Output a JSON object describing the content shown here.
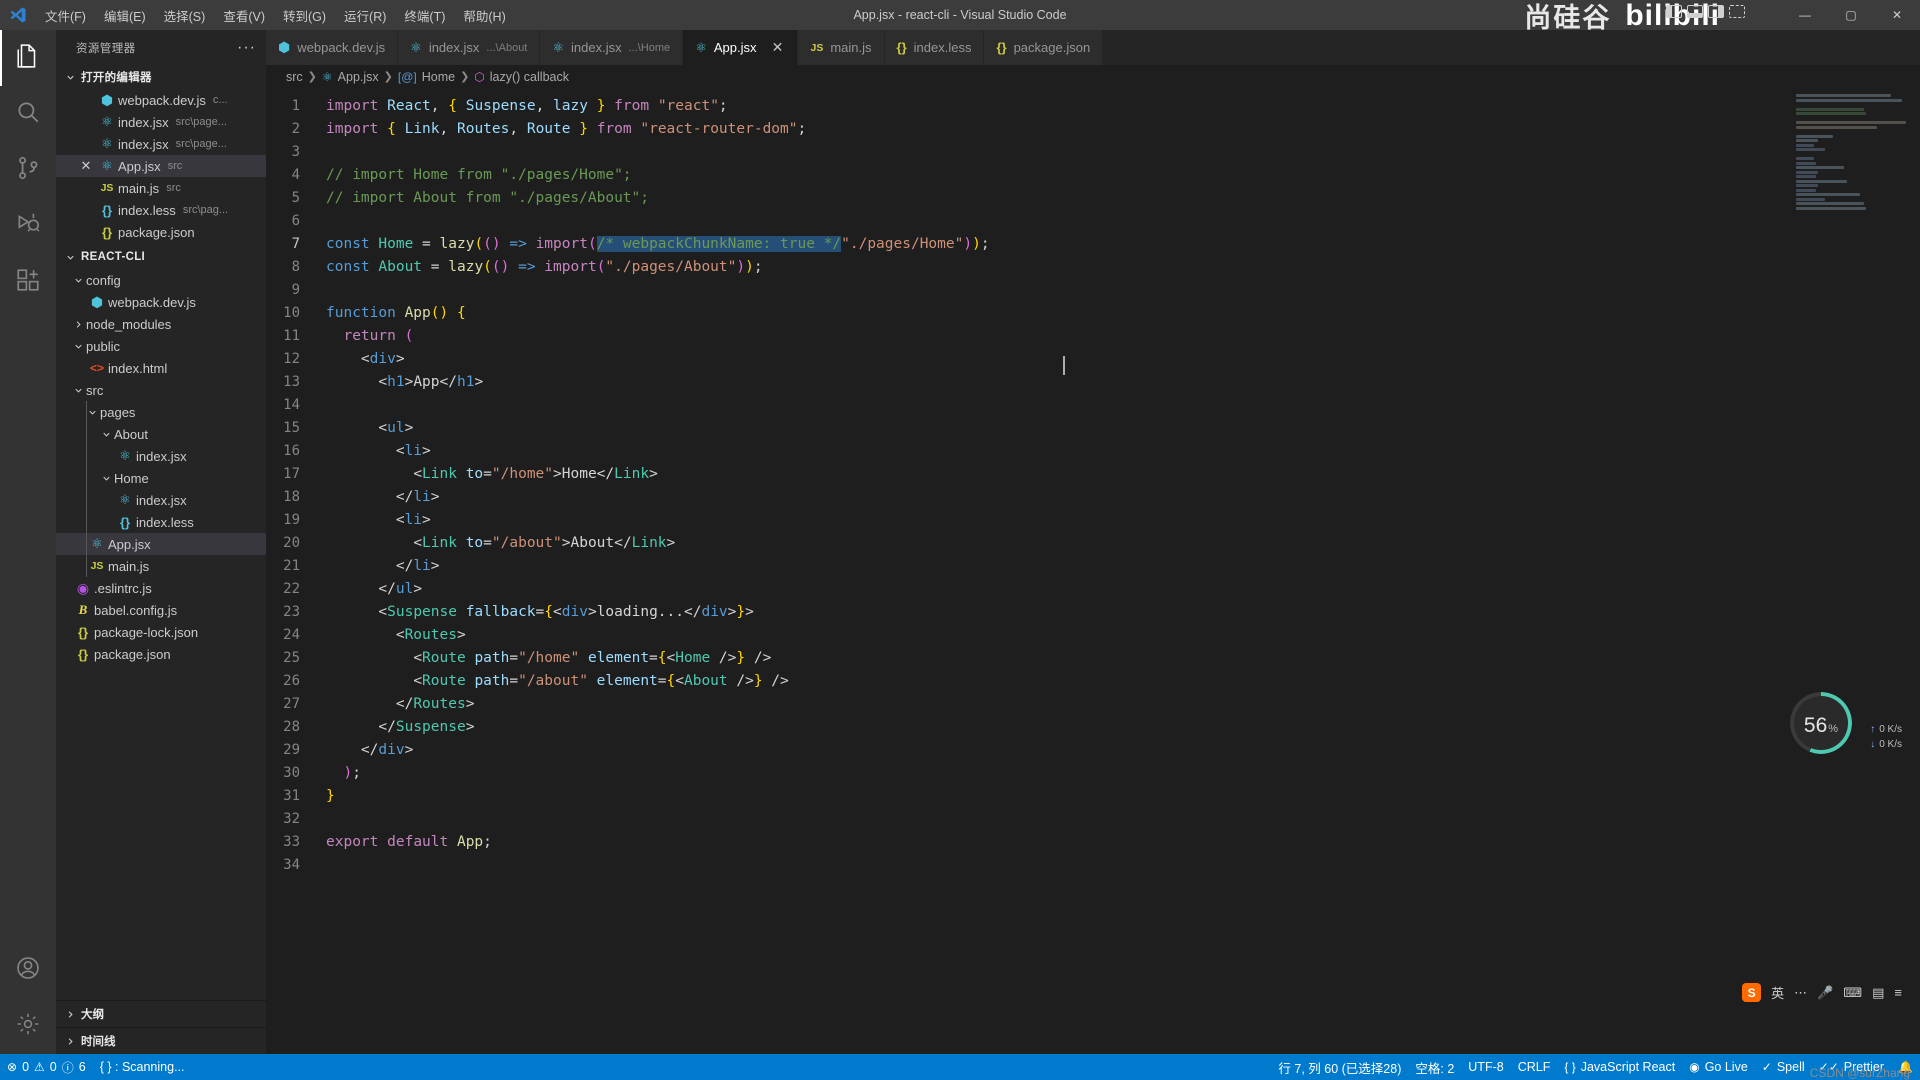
{
  "titlebar": {
    "logo_icon": "vscode-logo-icon",
    "window_title": "App.jsx - react-cli - Visual Studio Code",
    "menus": [
      {
        "label": "文件(F)",
        "name": "menu-file"
      },
      {
        "label": "编辑(E)",
        "name": "menu-edit"
      },
      {
        "label": "选择(S)",
        "name": "menu-selection"
      },
      {
        "label": "查看(V)",
        "name": "menu-view"
      },
      {
        "label": "转到(G)",
        "name": "menu-go"
      },
      {
        "label": "运行(R)",
        "name": "menu-run"
      },
      {
        "label": "终端(T)",
        "name": "menu-terminal"
      },
      {
        "label": "帮助(H)",
        "name": "menu-help"
      }
    ],
    "brand_cn": "尚硅谷",
    "brand_bili": "bilibili",
    "window_controls": {
      "minimize": "—",
      "maximize": "▢",
      "close": "✕"
    }
  },
  "activitybar": {
    "items": [
      {
        "name": "explorer",
        "icon": "files-icon",
        "active": true
      },
      {
        "name": "search",
        "icon": "search-icon",
        "active": false
      },
      {
        "name": "source-control",
        "icon": "source-control-icon",
        "active": false
      },
      {
        "name": "run-debug",
        "icon": "run-debug-icon",
        "active": false
      },
      {
        "name": "extensions",
        "icon": "extensions-icon",
        "active": false
      }
    ],
    "bottom": [
      {
        "name": "accounts",
        "icon": "account-icon"
      },
      {
        "name": "settings",
        "icon": "gear-icon"
      }
    ]
  },
  "sidebar": {
    "title": "资源管理器",
    "more_actions": "···",
    "open_editors": {
      "label": "打开的编辑器",
      "items": [
        {
          "name": "webpack.dev.js",
          "desc": "c...",
          "icon": "webpack-icon",
          "selected": false,
          "closable": false
        },
        {
          "name": "index.jsx",
          "desc": "src\\page...",
          "icon": "react-icon",
          "selected": false,
          "closable": false
        },
        {
          "name": "index.jsx",
          "desc": "src\\page...",
          "icon": "react-icon",
          "selected": false,
          "closable": false
        },
        {
          "name": "App.jsx",
          "desc": "src",
          "icon": "react-icon",
          "selected": true,
          "closable": true
        },
        {
          "name": "main.js",
          "desc": "src",
          "icon": "js-icon",
          "selected": false,
          "closable": false
        },
        {
          "name": "index.less",
          "desc": "src\\pag...",
          "icon": "less-icon",
          "selected": false,
          "closable": false
        },
        {
          "name": "package.json",
          "desc": "",
          "icon": "json-icon",
          "selected": false,
          "closable": false
        }
      ]
    },
    "project": {
      "label": "REACT-CLI",
      "tree": [
        {
          "name": "config",
          "type": "folder",
          "expanded": true,
          "indent": 1,
          "icon": "chevron-down-icon"
        },
        {
          "name": "webpack.dev.js",
          "type": "file",
          "indent": 2,
          "icon": "webpack-icon"
        },
        {
          "name": "node_modules",
          "type": "folder",
          "expanded": false,
          "indent": 1,
          "icon": "chevron-right-icon"
        },
        {
          "name": "public",
          "type": "folder",
          "expanded": true,
          "indent": 1,
          "icon": "chevron-down-icon"
        },
        {
          "name": "index.html",
          "type": "file",
          "indent": 2,
          "icon": "html-icon"
        },
        {
          "name": "src",
          "type": "folder",
          "expanded": true,
          "indent": 1,
          "icon": "chevron-down-icon"
        },
        {
          "name": "pages",
          "type": "folder",
          "expanded": true,
          "indent": 2,
          "icon": "chevron-down-icon"
        },
        {
          "name": "About",
          "type": "folder",
          "expanded": true,
          "indent": 3,
          "icon": "chevron-down-icon"
        },
        {
          "name": "index.jsx",
          "type": "file",
          "indent": 4,
          "icon": "react-icon"
        },
        {
          "name": "Home",
          "type": "folder",
          "expanded": true,
          "indent": 3,
          "icon": "chevron-down-icon"
        },
        {
          "name": "index.jsx",
          "type": "file",
          "indent": 4,
          "icon": "react-icon"
        },
        {
          "name": "index.less",
          "type": "file",
          "indent": 4,
          "icon": "less-icon"
        },
        {
          "name": "App.jsx",
          "type": "file",
          "indent": 2,
          "icon": "react-icon",
          "selected": true
        },
        {
          "name": "main.js",
          "type": "file",
          "indent": 2,
          "icon": "js-icon"
        },
        {
          "name": ".eslintrc.js",
          "type": "file",
          "indent": 1,
          "icon": "eslint-icon"
        },
        {
          "name": "babel.config.js",
          "type": "file",
          "indent": 1,
          "icon": "babel-icon"
        },
        {
          "name": "package-lock.json",
          "type": "file",
          "indent": 1,
          "icon": "json-icon"
        },
        {
          "name": "package.json",
          "type": "file",
          "indent": 1,
          "icon": "json-icon"
        }
      ]
    },
    "collapsed_sections": [
      {
        "label": "大纲",
        "name": "outline-section"
      },
      {
        "label": "时间线",
        "name": "timeline-section"
      }
    ]
  },
  "tabs": [
    {
      "label": "webpack.dev.js",
      "desc": "",
      "icon": "webpack-icon",
      "active": false,
      "closable": false
    },
    {
      "label": "index.jsx",
      "desc": "...\\About",
      "icon": "react-icon",
      "active": false,
      "closable": false
    },
    {
      "label": "index.jsx",
      "desc": "...\\Home",
      "icon": "react-icon",
      "active": false,
      "closable": false
    },
    {
      "label": "App.jsx",
      "desc": "",
      "icon": "react-icon",
      "active": true,
      "closable": true
    },
    {
      "label": "main.js",
      "desc": "",
      "icon": "js-icon",
      "active": false,
      "closable": false
    },
    {
      "label": "index.less",
      "desc": "",
      "icon": "json-icon",
      "active": false,
      "closable": false
    },
    {
      "label": "package.json",
      "desc": "",
      "icon": "json-icon",
      "active": false,
      "closable": false
    }
  ],
  "breadcrumb": [
    {
      "label": "src",
      "icon": ""
    },
    {
      "label": "App.jsx",
      "icon": "react-icon"
    },
    {
      "label": "Home",
      "icon": "constant-icon"
    },
    {
      "label": "lazy() callback",
      "icon": "symbol-icon"
    }
  ],
  "editor": {
    "line_count": 34,
    "cursor_line": 7,
    "lines": [
      {
        "n": 1,
        "text": "import React, { Suspense, lazy } from \"react\";"
      },
      {
        "n": 2,
        "text": "import { Link, Routes, Route } from \"react-router-dom\";"
      },
      {
        "n": 3,
        "text": ""
      },
      {
        "n": 4,
        "text": "// import Home from \"./pages/Home\";"
      },
      {
        "n": 5,
        "text": "// import About from \"./pages/About\";"
      },
      {
        "n": 6,
        "text": ""
      },
      {
        "n": 7,
        "text": "const Home = lazy(() => import(/* webpackChunkName: true */\"./pages/Home\"));"
      },
      {
        "n": 8,
        "text": "const About = lazy(() => import(\"./pages/About\"));"
      },
      {
        "n": 9,
        "text": ""
      },
      {
        "n": 10,
        "text": "function App() {"
      },
      {
        "n": 11,
        "text": "  return ("
      },
      {
        "n": 12,
        "text": "    <div>"
      },
      {
        "n": 13,
        "text": "      <h1>App</h1>"
      },
      {
        "n": 14,
        "text": ""
      },
      {
        "n": 15,
        "text": "      <ul>"
      },
      {
        "n": 16,
        "text": "        <li>"
      },
      {
        "n": 17,
        "text": "          <Link to=\"/home\">Home</Link>"
      },
      {
        "n": 18,
        "text": "        </li>"
      },
      {
        "n": 19,
        "text": "        <li>"
      },
      {
        "n": 20,
        "text": "          <Link to=\"/about\">About</Link>"
      },
      {
        "n": 21,
        "text": "        </li>"
      },
      {
        "n": 22,
        "text": "      </ul>"
      },
      {
        "n": 23,
        "text": "      <Suspense fallback={<div>loading...</div>}>"
      },
      {
        "n": 24,
        "text": "        <Routes>"
      },
      {
        "n": 25,
        "text": "          <Route path=\"/home\" element={<Home />} />"
      },
      {
        "n": 26,
        "text": "          <Route path=\"/about\" element={<About />} />"
      },
      {
        "n": 27,
        "text": "        </Routes>"
      },
      {
        "n": 28,
        "text": "      </Suspense>"
      },
      {
        "n": 29,
        "text": "    </div>"
      },
      {
        "n": 30,
        "text": "  );"
      },
      {
        "n": 31,
        "text": "}"
      },
      {
        "n": 32,
        "text": ""
      },
      {
        "n": 33,
        "text": "export default App;"
      },
      {
        "n": 34,
        "text": ""
      }
    ]
  },
  "overlays": {
    "network": {
      "percent": "56",
      "percent_symbol": "%",
      "up_speed": "0 K/s",
      "down_speed": "0 K/s",
      "up_icon": "arrow-up-icon",
      "down_icon": "arrow-down-icon"
    },
    "tray": {
      "ime_label": "英",
      "sogou_icon": "sogou-icon",
      "mic_icon": "microphone-icon",
      "keyboard_icon": "keyboard-icon",
      "panel_icon": "panel-icon",
      "menu_icon": "menu-icon",
      "more": "⋯"
    }
  },
  "statusbar": {
    "left": [
      {
        "name": "problems",
        "icon": "error-icon",
        "label": "0",
        "icon2": "warning-icon",
        "label2": "0",
        "icon3": "info-icon",
        "label3": "6"
      },
      {
        "name": "ports",
        "icon": "ports-icon",
        "label": ": Scanning..."
      }
    ],
    "errors": "0",
    "warnings": "0",
    "infos": "6",
    "ports_label": "{ } : Scanning...",
    "right": [
      {
        "name": "cursor-position",
        "label": "行 7, 列 60 (已选择28)"
      },
      {
        "name": "indentation",
        "label": "空格: 2"
      },
      {
        "name": "encoding",
        "label": "UTF-8"
      },
      {
        "name": "eol",
        "label": "CRLF"
      },
      {
        "name": "language-mode",
        "label": "JavaScript React",
        "icon": "braces-icon"
      },
      {
        "name": "go-live",
        "label": "Go Live",
        "icon": "broadcast-icon"
      },
      {
        "name": "spell-checker",
        "label": "Spell",
        "icon": "check-icon"
      },
      {
        "name": "prettier",
        "label": "Prettier",
        "icon": "double-check-icon"
      },
      {
        "name": "notifications",
        "label": "",
        "icon": "bell-icon"
      }
    ]
  },
  "watermark": "CSDN @surZhang"
}
